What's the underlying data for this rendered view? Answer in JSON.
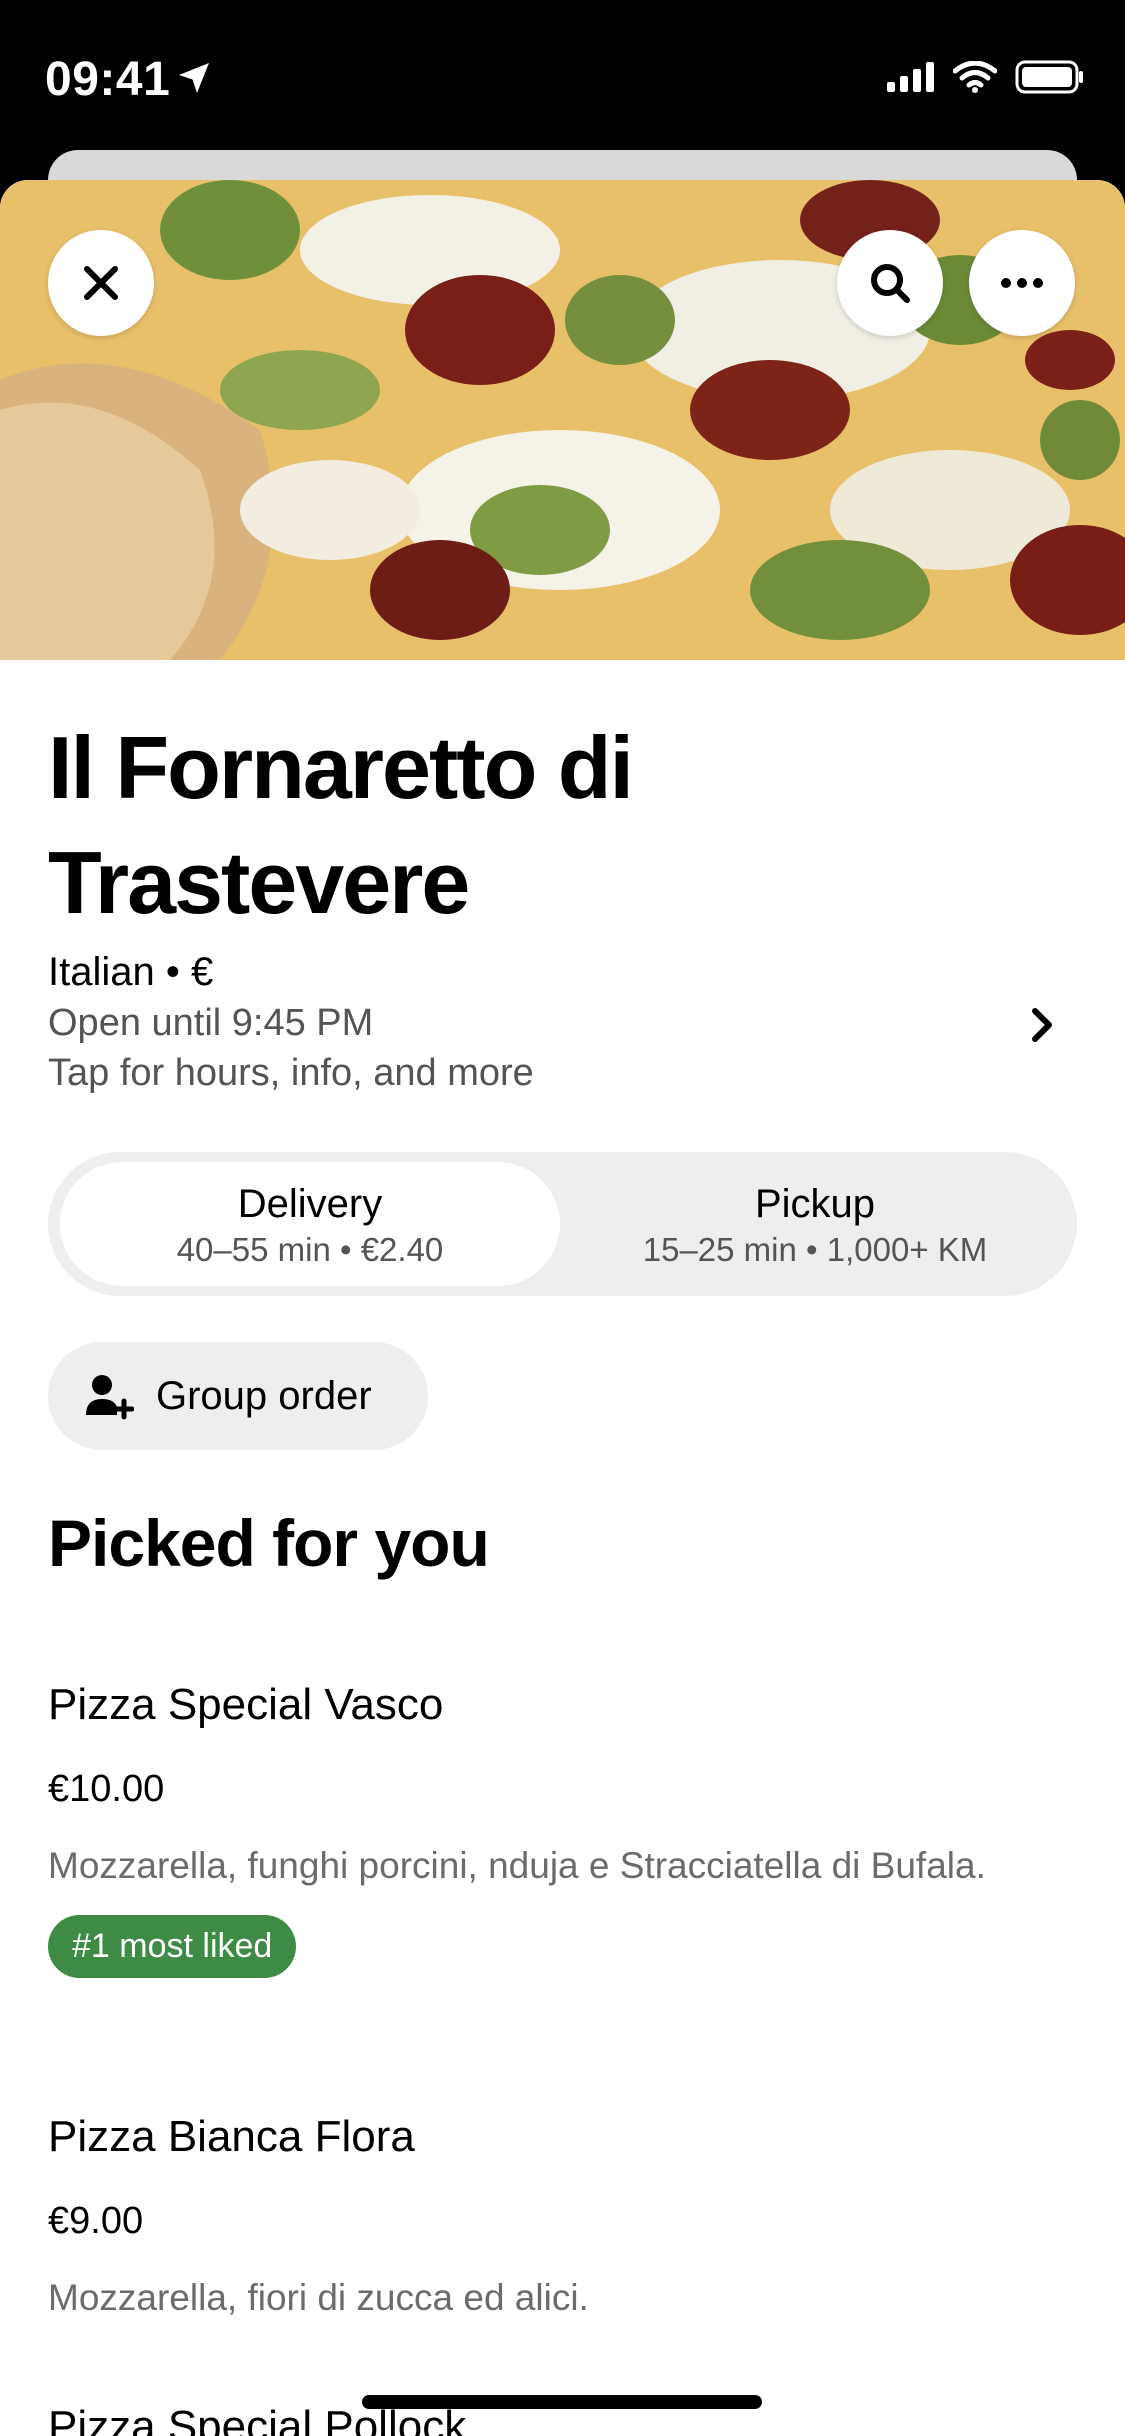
{
  "status_bar": {
    "time": "09:41"
  },
  "hero": {
    "image_alt": "Pizza with broccoli, nduja and mozzarella"
  },
  "actions": {
    "close_icon": "close-icon",
    "search_icon": "search-icon",
    "more_icon": "more-horizontal-icon"
  },
  "restaurant": {
    "name": "Il Fornaretto di Trastevere",
    "cuisine": "Italian • €",
    "hours": "Open until 9:45 PM",
    "info_hint": "Tap for hours, info, and more"
  },
  "mode_toggle": {
    "selected": "Delivery",
    "delivery": {
      "label": "Delivery",
      "detail": "40–55 min • €2.40"
    },
    "pickup": {
      "label": "Pickup",
      "detail": "15–25 min • 1,000+ KM"
    }
  },
  "group_order": {
    "label": "Group order"
  },
  "section": {
    "title": "Picked for you"
  },
  "menu_items": [
    {
      "name": "Pizza Special Vasco",
      "price": "€10.00",
      "description": "Mozzarella, funghi porcini, nduja e Stracciatella di Bufala.",
      "badge": "#1 most liked"
    },
    {
      "name": "Pizza Bianca Flora",
      "price": "€9.00",
      "description": "Mozzarella, fiori di zucca ed alici."
    },
    {
      "name": "Pizza Special Pollock"
    }
  ],
  "colors": {
    "badge_green": "#3d8b45",
    "secondary_text": "#545454",
    "chip_background": "#eeeeee"
  }
}
